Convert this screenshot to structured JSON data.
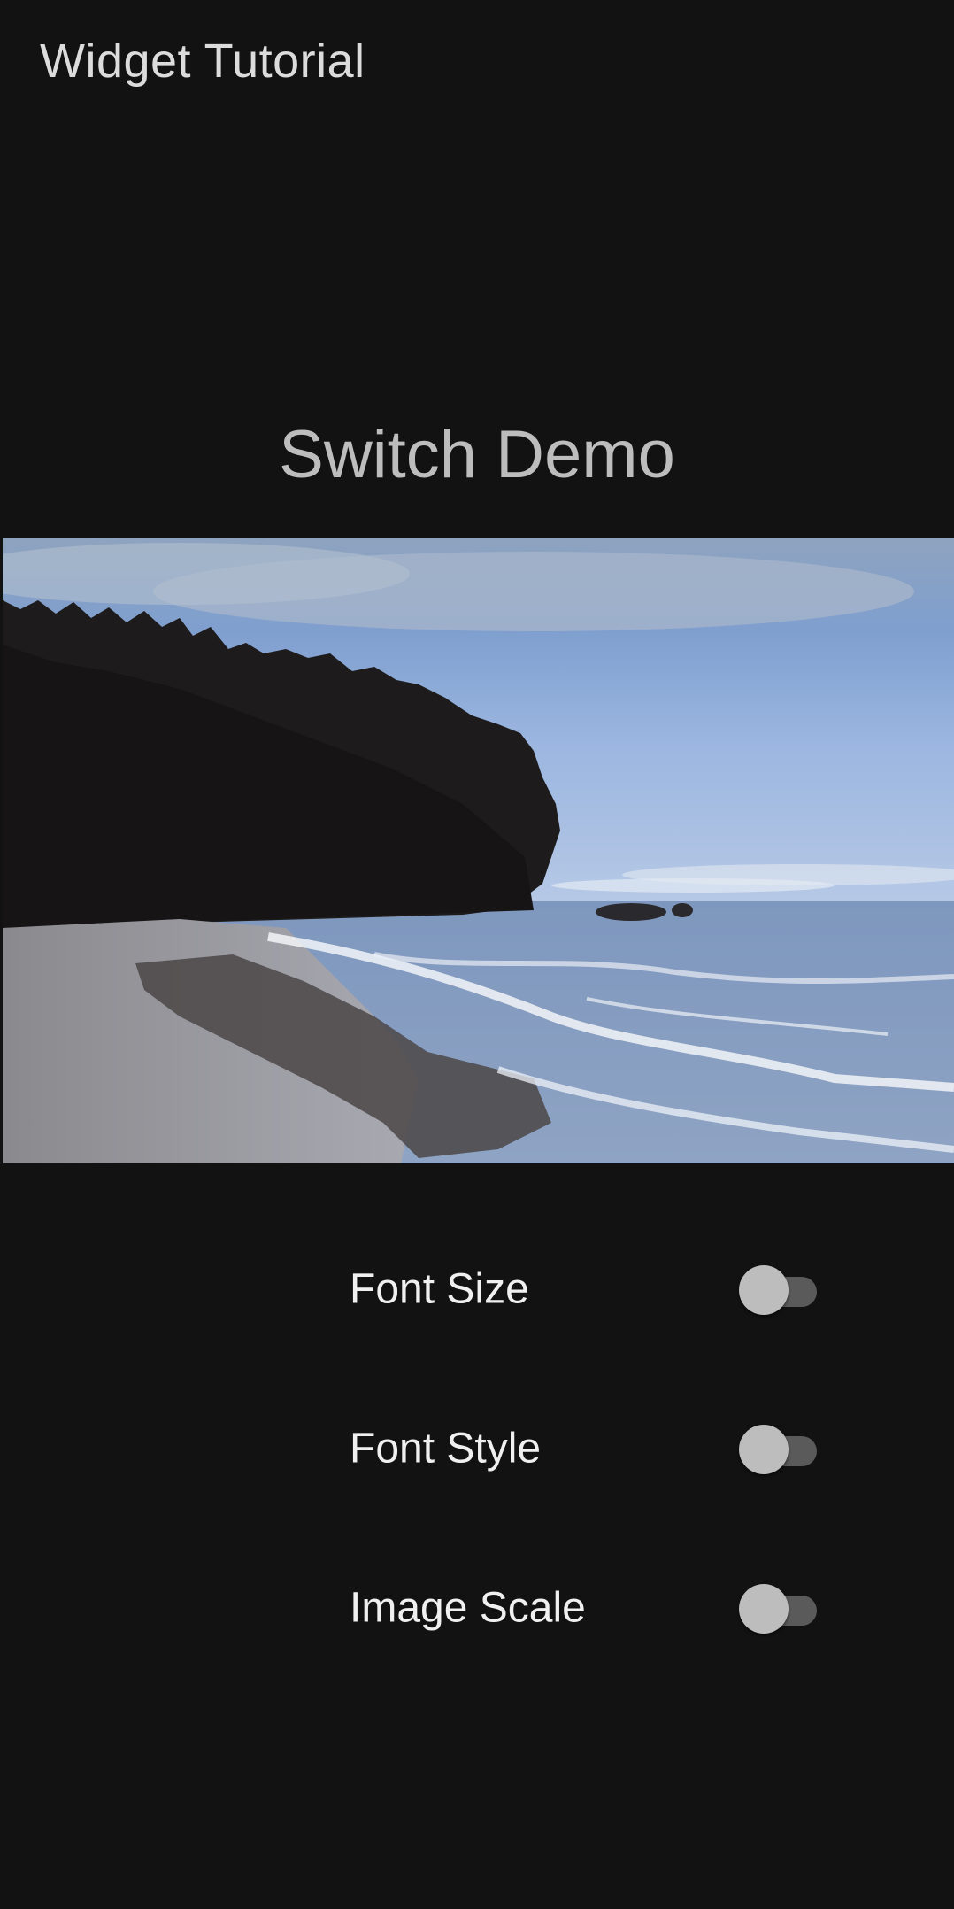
{
  "app_bar": {
    "title": "Widget Tutorial"
  },
  "main": {
    "heading": "Switch Demo",
    "image": {
      "subject": "coastal beach with evergreen trees and waves"
    },
    "settings": [
      {
        "label": "Font Size",
        "checked": false
      },
      {
        "label": "Font Style",
        "checked": false
      },
      {
        "label": "Image Scale",
        "checked": false
      }
    ]
  },
  "colors": {
    "background": "#121212",
    "switch_thumb_off": "#bdbdbd",
    "switch_track_off": "#5a5a5a"
  }
}
